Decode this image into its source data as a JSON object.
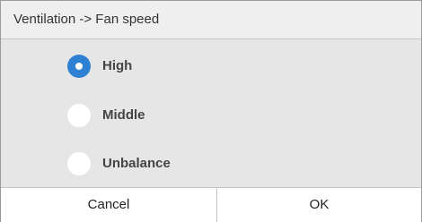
{
  "dialog": {
    "title": "Ventilation -> Fan speed",
    "options": [
      {
        "label": "High",
        "selected": true
      },
      {
        "label": "Middle",
        "selected": false
      },
      {
        "label": "Unbalance",
        "selected": false
      }
    ],
    "cancel_label": "Cancel",
    "ok_label": "OK"
  },
  "colors": {
    "radio_selected": "#2f80d3",
    "radio_unselected": "#ffffff",
    "panel_background": "#e6e6e6"
  }
}
